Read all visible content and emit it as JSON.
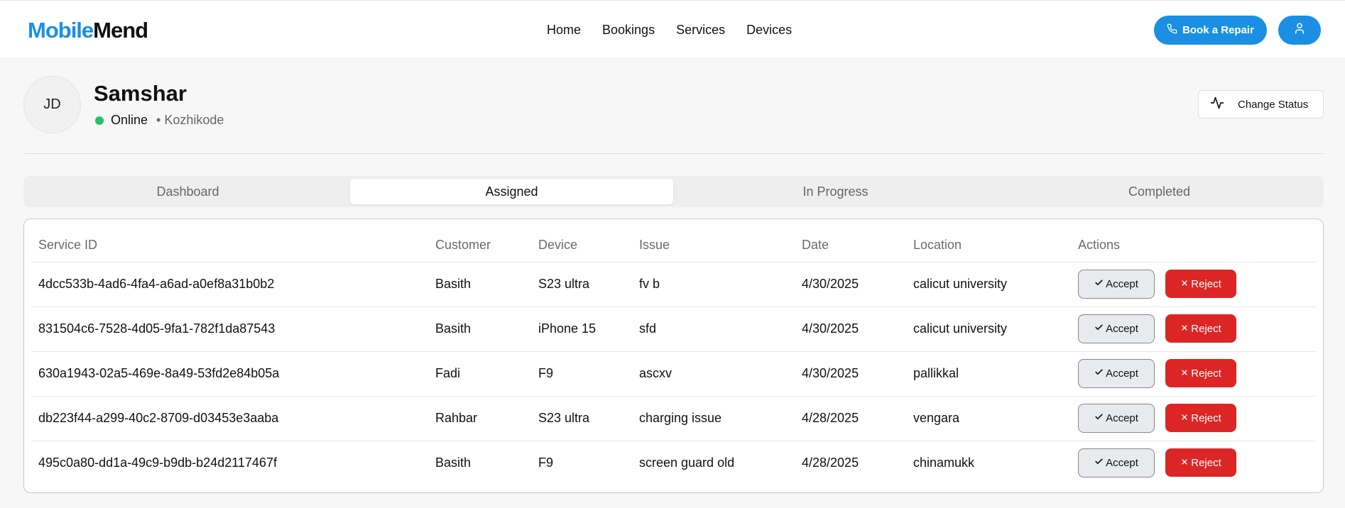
{
  "brand": {
    "part1": "Mobile",
    "part2": "Mend"
  },
  "nav": {
    "home": "Home",
    "bookings": "Bookings",
    "services": "Services",
    "devices": "Devices"
  },
  "header": {
    "book_label": "Book a Repair"
  },
  "profile": {
    "initials": "JD",
    "name": "Samshar",
    "status": "Online",
    "location": "• Kozhikode",
    "change_status_label": "Change Status"
  },
  "tabs": [
    "Dashboard",
    "Assigned",
    "In Progress",
    "Completed"
  ],
  "table": {
    "headers": [
      "Service ID",
      "Customer",
      "Device",
      "Issue",
      "Date",
      "Location",
      "Actions"
    ],
    "accept_label": "Accept",
    "reject_label": "Reject",
    "rows": [
      [
        "4dcc533b-4ad6-4fa4-a6ad-a0ef8a31b0b2",
        "Basith",
        "S23 ultra",
        "fv b",
        "4/30/2025",
        "calicut university"
      ],
      [
        "831504c6-7528-4d05-9fa1-782f1da87543",
        "Basith",
        "iPhone 15",
        "sfd",
        "4/30/2025",
        "calicut university"
      ],
      [
        "630a1943-02a5-469e-8a49-53fd2e84b05a",
        "Fadi",
        "F9",
        "ascxv",
        "4/30/2025",
        "pallikkal"
      ],
      [
        "db223f44-a299-40c2-8709-d03453e3aaba",
        "Rahbar",
        "S23 ultra",
        "charging issue",
        "4/28/2025",
        "vengara"
      ],
      [
        "495c0a80-dd1a-49c9-b9db-b24d2117467f",
        "Basith",
        "F9",
        "screen guard old",
        "4/28/2025",
        "chinamukk"
      ]
    ]
  }
}
